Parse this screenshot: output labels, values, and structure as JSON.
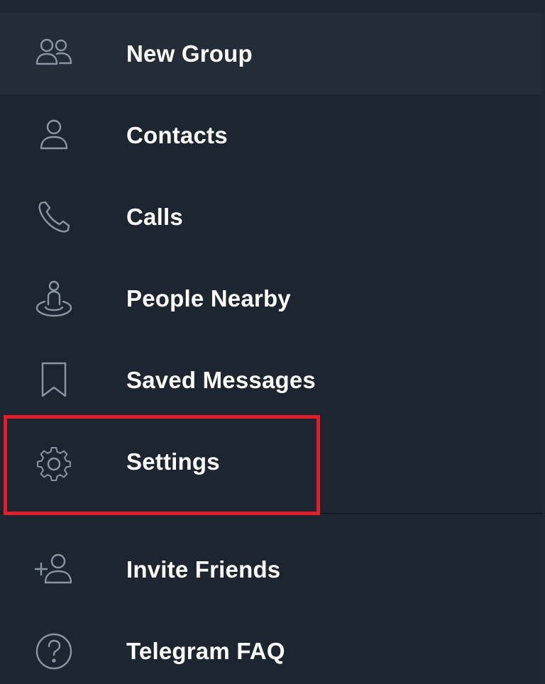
{
  "menu": {
    "items": [
      {
        "label": "New Group",
        "icon": "group-icon"
      },
      {
        "label": "Contacts",
        "icon": "contact-icon"
      },
      {
        "label": "Calls",
        "icon": "phone-icon"
      },
      {
        "label": "People Nearby",
        "icon": "people-nearby-icon"
      },
      {
        "label": "Saved Messages",
        "icon": "bookmark-icon"
      },
      {
        "label": "Settings",
        "icon": "gear-icon"
      }
    ],
    "secondary_items": [
      {
        "label": "Invite Friends",
        "icon": "add-person-icon"
      },
      {
        "label": "Telegram FAQ",
        "icon": "question-icon"
      }
    ]
  },
  "colors": {
    "background": "#1d2530",
    "highlight_row": "#232c37",
    "icon": "#8a96a3",
    "text": "#ffffff",
    "annotation": "#e11d2a"
  }
}
